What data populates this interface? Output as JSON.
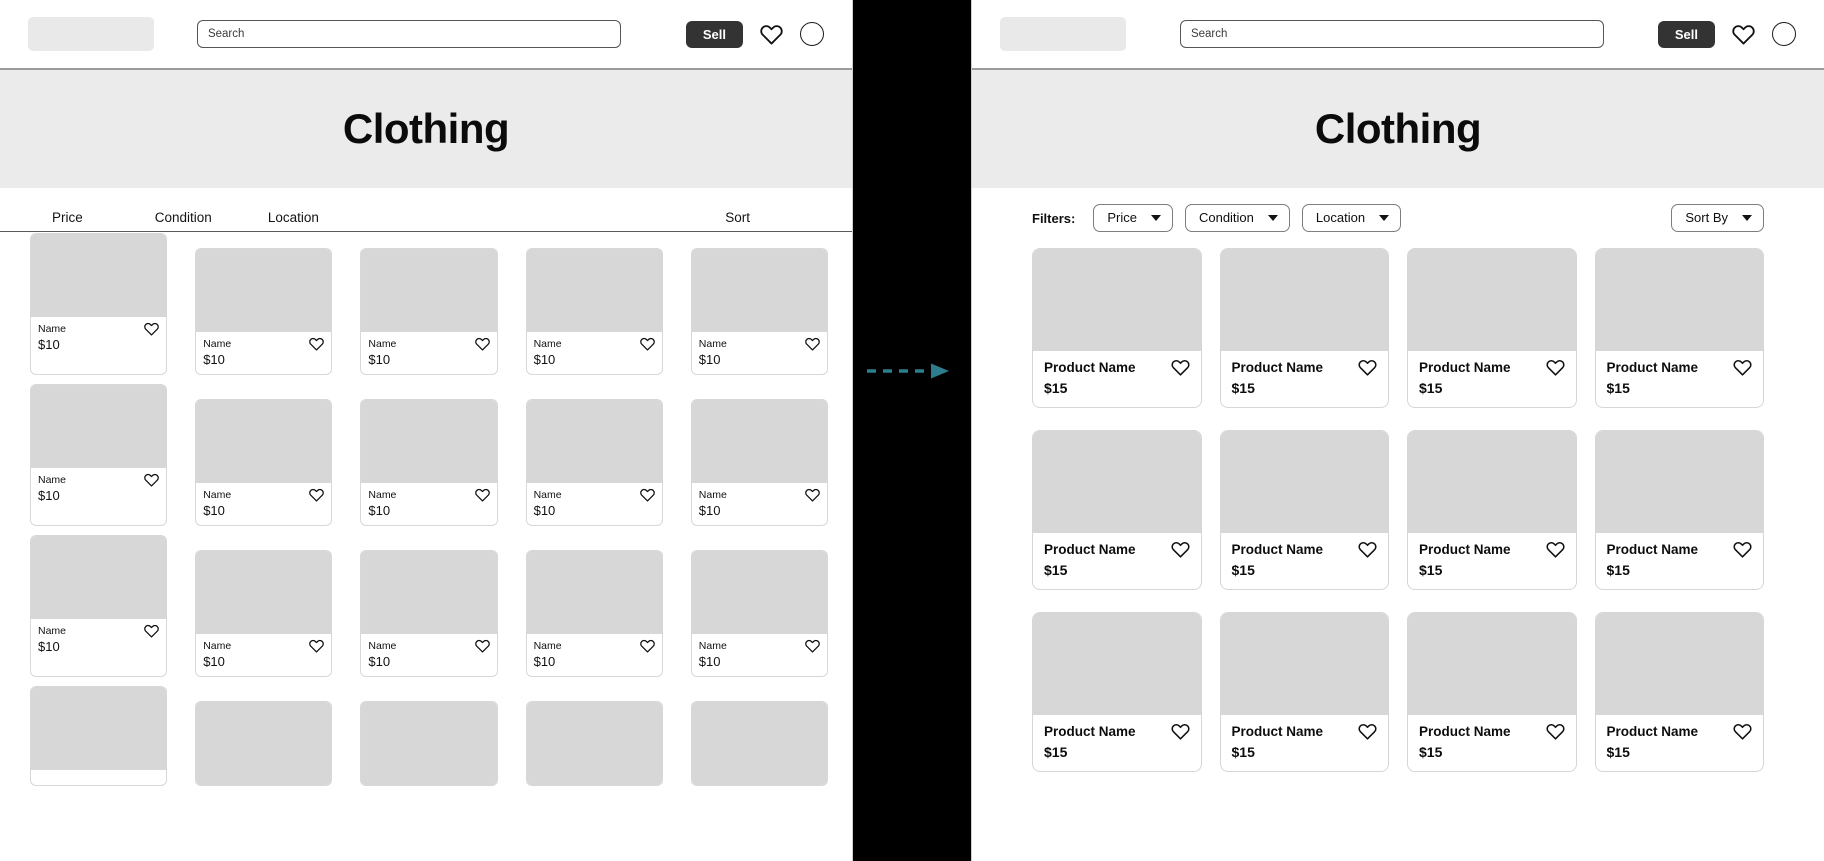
{
  "accent": {
    "arrow": "#2e7d8f",
    "sell_button_bg": "#333333",
    "hero_bg": "#ebebeb",
    "thumb_bg": "#d7d7d7"
  },
  "left_panel": {
    "topbar": {
      "logo_name": "logo-placeholder",
      "search_placeholder": "Search",
      "search_value": "",
      "sell_label": "Sell",
      "wishlist_icon": "heart-icon",
      "account_icon": "avatar-circle-icon"
    },
    "hero": {
      "title": "Clothing"
    },
    "filters": {
      "items": [
        {
          "label": "Price"
        },
        {
          "label": "Condition"
        },
        {
          "label": "Location"
        }
      ],
      "sort_label": "Sort"
    },
    "products": [
      {
        "name": "Name",
        "price": "$10"
      },
      {
        "name": "Name",
        "price": "$10"
      },
      {
        "name": "Name",
        "price": "$10"
      },
      {
        "name": "Name",
        "price": "$10"
      },
      {
        "name": "Name",
        "price": "$10"
      },
      {
        "name": "Name",
        "price": "$10"
      },
      {
        "name": "Name",
        "price": "$10"
      },
      {
        "name": "Name",
        "price": "$10"
      },
      {
        "name": "Name",
        "price": "$10"
      },
      {
        "name": "Name",
        "price": "$10"
      },
      {
        "name": "Name",
        "price": "$10"
      },
      {
        "name": "Name",
        "price": "$10"
      },
      {
        "name": "Name",
        "price": "$10"
      },
      {
        "name": "Name",
        "price": "$10"
      },
      {
        "name": "Name",
        "price": "$10"
      },
      {
        "name": "",
        "price": ""
      },
      {
        "name": "",
        "price": ""
      },
      {
        "name": "",
        "price": ""
      },
      {
        "name": "",
        "price": ""
      },
      {
        "name": "",
        "price": ""
      }
    ]
  },
  "right_panel": {
    "topbar": {
      "logo_name": "logo-placeholder",
      "search_placeholder": "Search",
      "search_value": "",
      "sell_label": "Sell",
      "wishlist_icon": "heart-icon",
      "account_icon": "avatar-circle-icon"
    },
    "hero": {
      "title": "Clothing"
    },
    "filters": {
      "label": "Filters:",
      "items": [
        {
          "label": "Price"
        },
        {
          "label": "Condition"
        },
        {
          "label": "Location"
        }
      ],
      "sort_label": "Sort By"
    },
    "products": [
      {
        "name": "Product Name",
        "price": "$15"
      },
      {
        "name": "Product Name",
        "price": "$15"
      },
      {
        "name": "Product Name",
        "price": "$15"
      },
      {
        "name": "Product Name",
        "price": "$15"
      },
      {
        "name": "Product Name",
        "price": "$15"
      },
      {
        "name": "Product Name",
        "price": "$15"
      },
      {
        "name": "Product Name",
        "price": "$15"
      },
      {
        "name": "Product Name",
        "price": "$15"
      },
      {
        "name": "Product Name",
        "price": "$15"
      },
      {
        "name": "Product Name",
        "price": "$15"
      },
      {
        "name": "Product Name",
        "price": "$15"
      },
      {
        "name": "Product Name",
        "price": "$15"
      }
    ]
  },
  "divider": {
    "arrow_icon": "dashed-arrow-right-icon"
  }
}
